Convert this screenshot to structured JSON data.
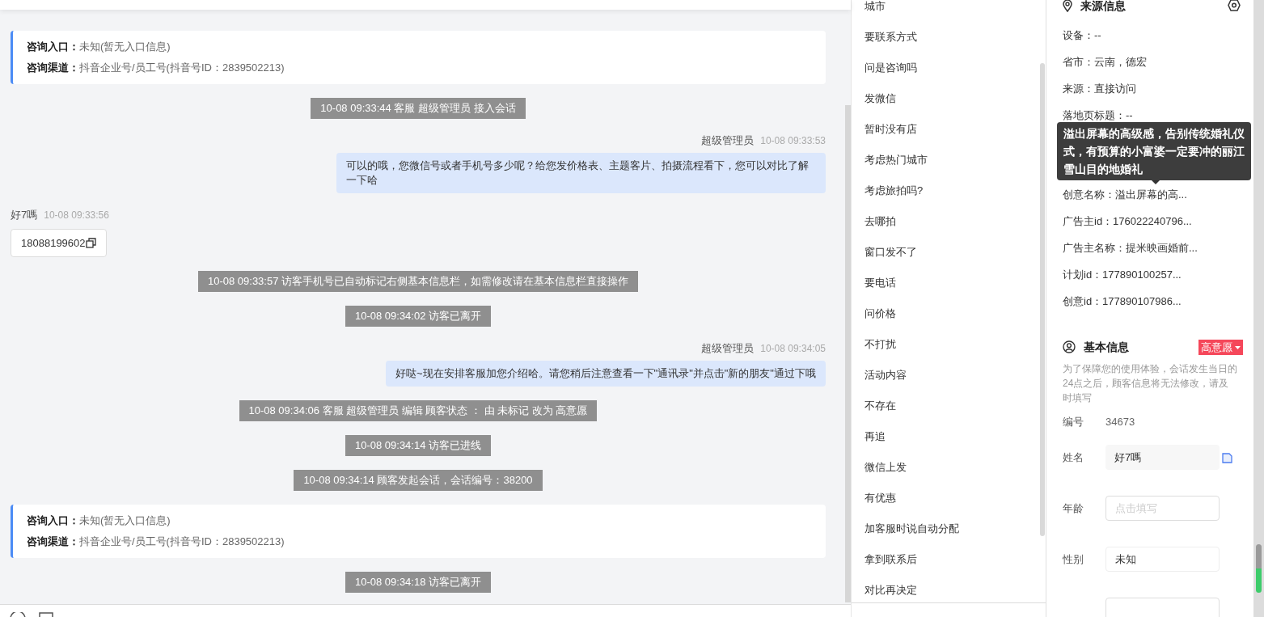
{
  "chat": {
    "messages": [
      {
        "kind": "info",
        "rows": [
          {
            "label": "咨询入口：",
            "value": "未知(暂无入口信息)"
          },
          {
            "label": "咨询渠道：",
            "value": "抖音企业号/员工号(抖音号ID：2839502213)"
          }
        ]
      },
      {
        "kind": "notice",
        "text": "10-08 09:33:44 客服 超级管理员 接入会话"
      },
      {
        "kind": "agent",
        "sender": "超级管理员",
        "time": "10-08 09:33:53",
        "text": "可以的哦，您微信号或者手机号多少呢？给您发价格表、主题客片、拍摄流程看下，您可以对比了解一下哈"
      },
      {
        "kind": "visitor",
        "sender": "好7嗎",
        "time": "10-08 09:33:56",
        "text": "18088199602"
      },
      {
        "kind": "notice",
        "text": "10-08 09:33:57 访客手机号已自动标记右侧基本信息栏，如需修改请在基本信息栏直接操作"
      },
      {
        "kind": "notice",
        "text": "10-08 09:34:02 访客已离开"
      },
      {
        "kind": "agent",
        "sender": "超级管理员",
        "time": "10-08 09:34:05",
        "text": "好哒~现在安排客服加您介绍哈。请您稍后注意查看一下\"通讯录\"并点击\"新的朋友\"通过下哦"
      },
      {
        "kind": "notice",
        "text": "10-08 09:34:06 客服 超级管理员 编辑 顾客状态 ： 由 未标记 改为 高意愿"
      },
      {
        "kind": "notice",
        "text": "10-08 09:34:14 访客已进线"
      },
      {
        "kind": "notice",
        "text": "10-08 09:34:14 顾客发起会话，会话编号：38200"
      },
      {
        "kind": "info",
        "rows": [
          {
            "label": "咨询入口：",
            "value": "未知(暂无入口信息)"
          },
          {
            "label": "咨询渠道：",
            "value": "抖音企业号/员工号(抖音号ID：2839502213)"
          }
        ]
      },
      {
        "kind": "notice",
        "text": "10-08 09:34:18 访客已离开"
      }
    ]
  },
  "quick_replies": [
    "城市",
    "要联系方式",
    "问是咨询吗",
    "发微信",
    "暂时没有店",
    "考虑热门城市",
    "考虑旅拍吗?",
    "去哪拍",
    "窗口发不了",
    "要电话",
    "问价格",
    "不打扰",
    "活动内容",
    "不存在",
    "再追",
    "微信上发",
    "有优惠",
    "加客服时说自动分配",
    "拿到联系后",
    "对比再决定"
  ],
  "source_info": {
    "title": "来源信息",
    "rows": [
      "设备：--",
      "省市：云南，德宏",
      "来源：直接访问",
      "落地页标题：--"
    ],
    "rows_below": [
      "创意名称：溢出屏幕的高...",
      "广告主id：176022240796...",
      "广告主名称：提米映画婚前...",
      "计划id：177890100257...",
      "创意id：177890107986..."
    ],
    "tooltip": "溢出屏幕的高级感，告别传统婚礼仪式，有预算的小富婆一定要冲的丽江雪山目的地婚礼"
  },
  "basic_info": {
    "title": "基本信息",
    "status": "高意愿",
    "note": "为了保障您的使用体验，会话发生当日的24点之后，顾客信息将无法修改，请及时填写",
    "fields": [
      {
        "kind": "text",
        "label": "编号",
        "value": "34673"
      },
      {
        "kind": "filled",
        "label": "姓名",
        "value": "好7嗎"
      },
      {
        "kind": "input",
        "label": "年龄",
        "placeholder": "点击填写"
      },
      {
        "kind": "select",
        "label": "性别",
        "value": "未知"
      },
      {
        "kind": "input_cut"
      }
    ]
  }
}
